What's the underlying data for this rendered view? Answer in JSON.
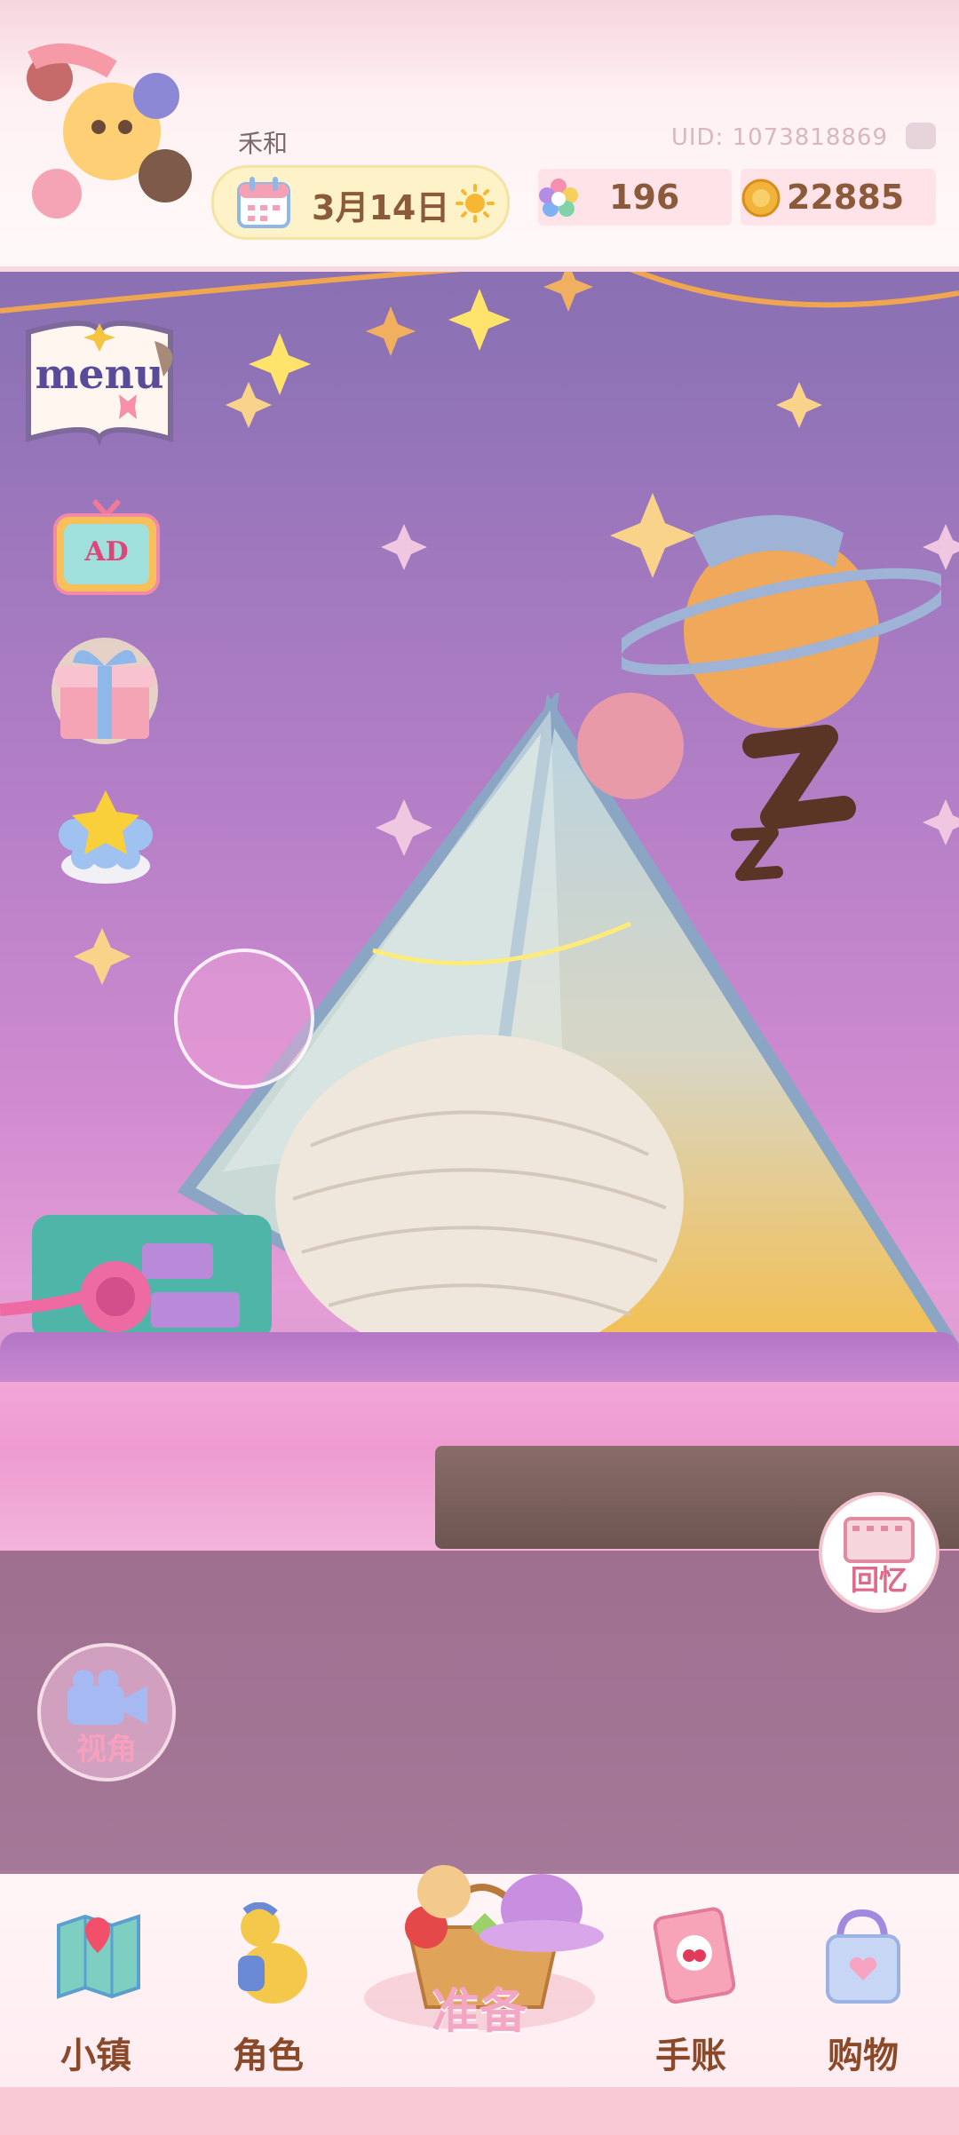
{
  "header": {
    "player_name": "禾和",
    "date": "3月14日",
    "uid": "UID: 1073818869",
    "gems": "196",
    "coins": "22885"
  },
  "left_menu": {
    "menu_label": "menu",
    "ad_label": "AD"
  },
  "scene_buttons": {
    "memories": "回忆",
    "camera_view": "视角"
  },
  "bottom_nav": {
    "items": [
      {
        "label": "小镇",
        "icon": "map-icon"
      },
      {
        "label": "角色",
        "icon": "character-icon"
      },
      {
        "label": "准备",
        "icon": "picnic-basket-icon"
      },
      {
        "label": "手账",
        "icon": "journal-icon"
      },
      {
        "label": "购物",
        "icon": "shopping-bag-icon"
      }
    ]
  }
}
